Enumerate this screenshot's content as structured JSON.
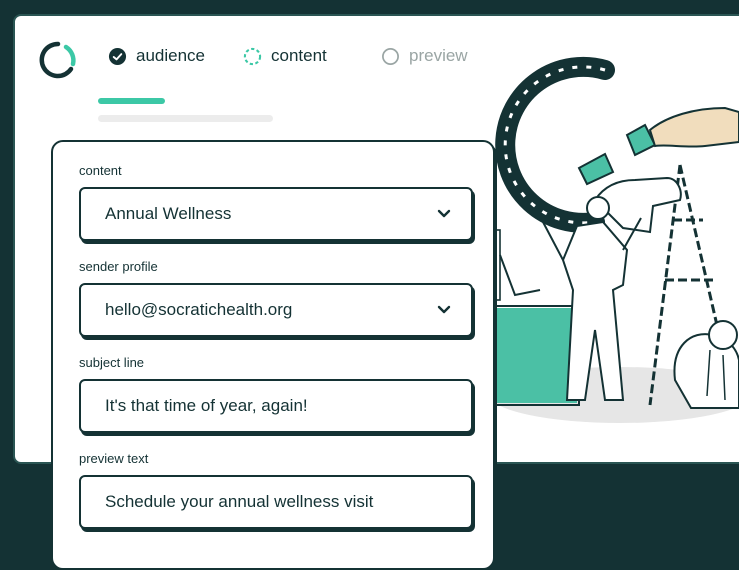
{
  "steps": [
    {
      "label": "audience",
      "icon": "check-circle-icon",
      "state": "done"
    },
    {
      "label": "content",
      "icon": "dashed-circle-icon",
      "state": "active"
    },
    {
      "label": "preview",
      "icon": "empty-circle-icon",
      "state": "upcoming"
    }
  ],
  "form": {
    "content": {
      "label": "content",
      "value": "Annual Wellness"
    },
    "sender_profile": {
      "label": "sender profile",
      "value": "hello@socratichealth.org"
    },
    "subject_line": {
      "label": "subject line",
      "value": "It's that time of year, again!"
    },
    "preview_text": {
      "label": "preview text",
      "value": "Schedule your annual wellness visit"
    }
  },
  "colors": {
    "background": "#143234",
    "accent": "#3cc8a6",
    "text": "#143234",
    "muted": "#9aa5a4"
  }
}
